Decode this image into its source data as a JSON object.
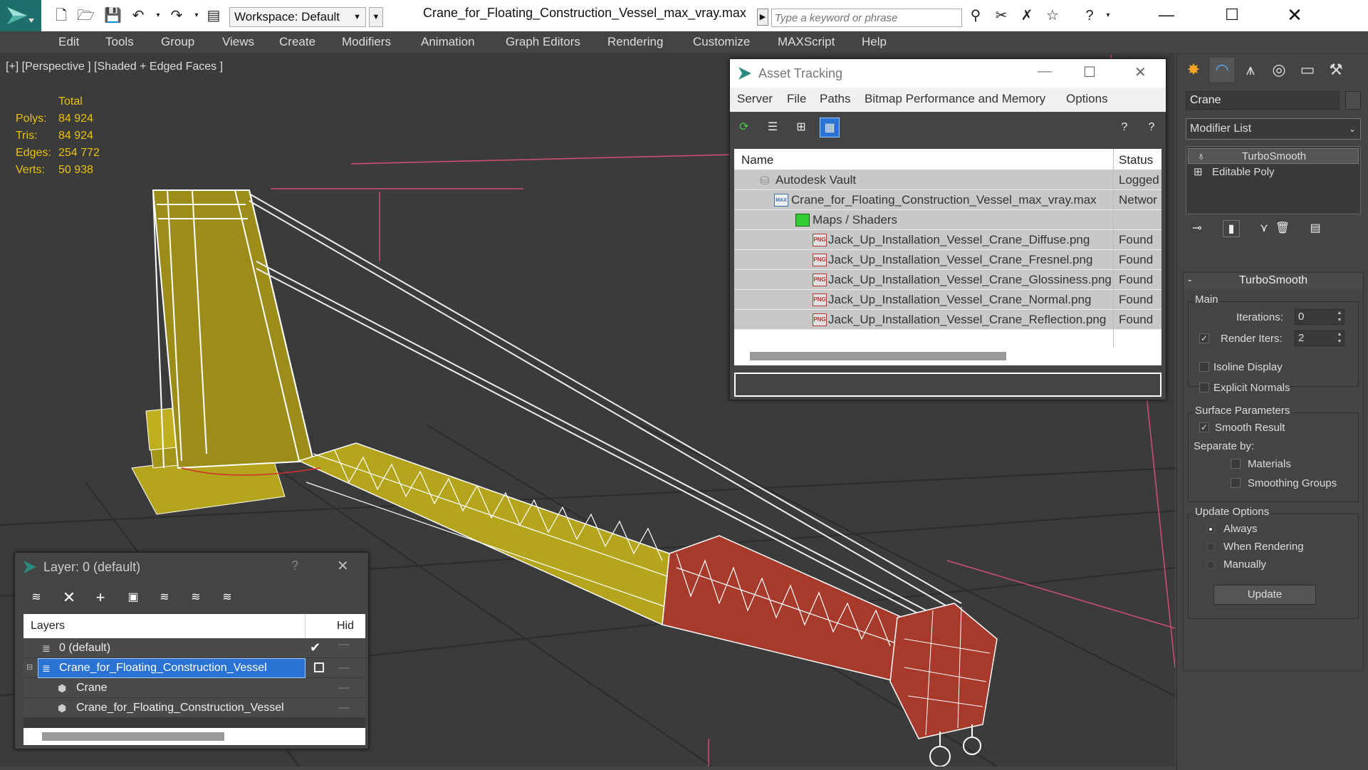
{
  "titlebar": {
    "workspace": "Workspace: Default",
    "document_title": "Crane_for_Floating_Construction_Vessel_max_vray.max",
    "search_placeholder": "Type a keyword or phrase"
  },
  "menubar": {
    "items": [
      "Edit",
      "Tools",
      "Group",
      "Views",
      "Create",
      "Modifiers",
      "Animation",
      "Graph Editors",
      "Rendering",
      "Customize",
      "MAXScript",
      "Help"
    ]
  },
  "viewport": {
    "label": "[+] [Perspective ] [Shaded + Edged Faces ]",
    "stats": {
      "header": "Total",
      "rows": [
        {
          "label": "Polys:",
          "value": "84 924"
        },
        {
          "label": "Tris:",
          "value": "84 924"
        },
        {
          "label": "Edges:",
          "value": "254 772"
        },
        {
          "label": "Verts:",
          "value": "50 938"
        }
      ]
    }
  },
  "asset_tracking": {
    "title": "Asset Tracking",
    "menu": [
      "Server",
      "File",
      "Paths",
      "Bitmap Performance and Memory",
      "Options"
    ],
    "columns": {
      "name": "Name",
      "status": "Status"
    },
    "rows": [
      {
        "name": "Autodesk Vault",
        "status": "Logged",
        "icon": "vault-icon"
      },
      {
        "name": "Crane_for_Floating_Construction_Vessel_max_vray.max",
        "status": "Networ",
        "icon": "max-file-icon"
      },
      {
        "name": "Maps / Shaders",
        "status": "",
        "icon": "maps-icon"
      },
      {
        "name": "Jack_Up_Installation_Vessel_Crane_Diffuse.png",
        "status": "Found",
        "icon": "png-icon"
      },
      {
        "name": "Jack_Up_Installation_Vessel_Crane_Fresnel.png",
        "status": "Found",
        "icon": "png-icon"
      },
      {
        "name": "Jack_Up_Installation_Vessel_Crane_Glossiness.png",
        "status": "Found",
        "icon": "png-icon"
      },
      {
        "name": "Jack_Up_Installation_Vessel_Crane_Normal.png",
        "status": "Found",
        "icon": "png-icon"
      },
      {
        "name": "Jack_Up_Installation_Vessel_Crane_Reflection.png",
        "status": "Found",
        "icon": "png-icon"
      }
    ],
    "png_tag": "PNG",
    "max_tag": "MAX"
  },
  "layer_window": {
    "title": "Layer: 0 (default)",
    "help": "?",
    "columns": {
      "name": "Layers",
      "hide": "Hid"
    },
    "rows": [
      {
        "name": "0 (default)"
      },
      {
        "name": "Crane_for_Floating_Construction_Vessel"
      },
      {
        "name": "Crane"
      },
      {
        "name": "Crane_for_Floating_Construction_Vessel"
      }
    ]
  },
  "command_panel": {
    "object_name": "Crane",
    "modifier_list": "Modifier List",
    "stack": [
      "TurboSmooth",
      "Editable Poly"
    ],
    "rollout_title": "TurboSmooth",
    "main_group": "Main",
    "iterations_label": "Iterations:",
    "iterations_value": "0",
    "render_iters_label": "Render Iters:",
    "render_iters_value": "2",
    "isoline_display": "Isoline Display",
    "explicit_normals": "Explicit Normals",
    "surface_params": "Surface Parameters",
    "smooth_result": "Smooth Result",
    "separate_by": "Separate by:",
    "materials": "Materials",
    "smoothing_groups": "Smoothing Groups",
    "update_options": "Update Options",
    "always": "Always",
    "when_rendering": "When Rendering",
    "manually": "Manually",
    "update_button": "Update"
  },
  "colors": {
    "accent_selection": "#2a72d4",
    "stats_yellow": "#e8c20e",
    "logo_teal": "#1c6f6a",
    "model_yellow": "#b5a51c",
    "model_red": "#a83a2c"
  }
}
